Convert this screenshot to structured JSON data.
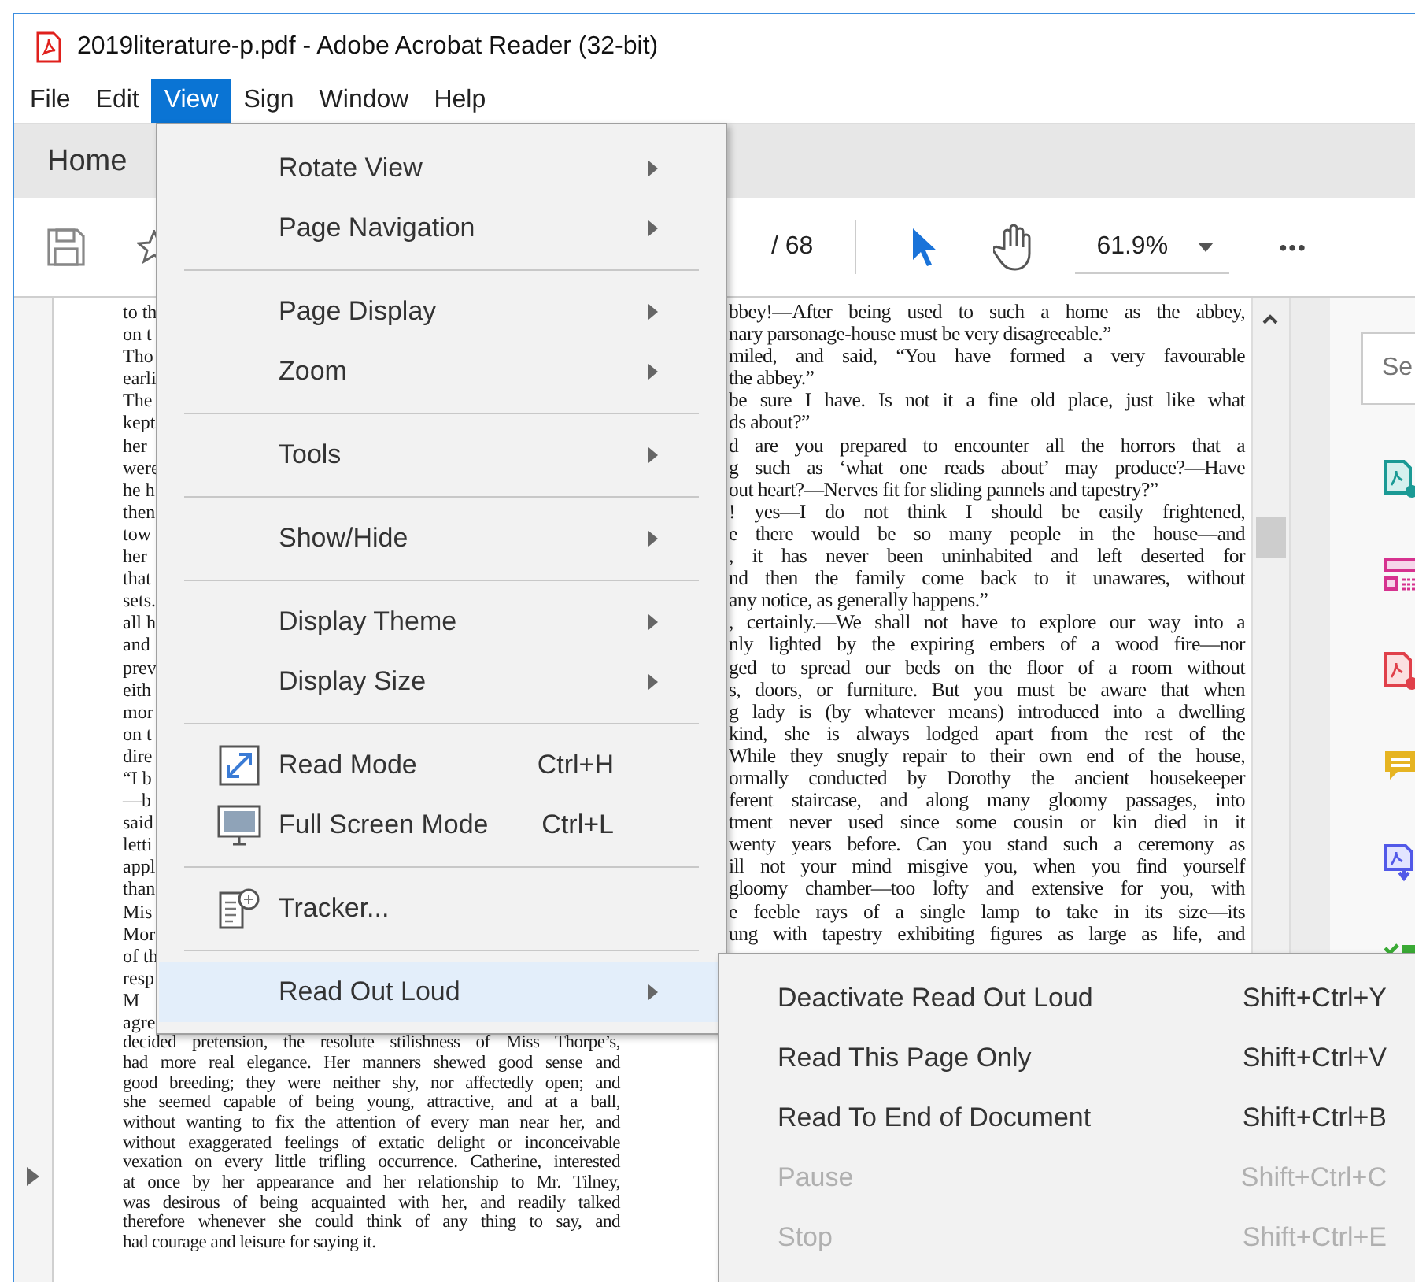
{
  "window": {
    "title": "2019literature-p.pdf - Adobe Acrobat Reader (32-bit)"
  },
  "menu_bar": [
    {
      "label": "File",
      "selected": false
    },
    {
      "label": "Edit",
      "selected": false
    },
    {
      "label": "View",
      "selected": true
    },
    {
      "label": "Sign",
      "selected": false
    },
    {
      "label": "Window",
      "selected": false
    },
    {
      "label": "Help",
      "selected": false
    }
  ],
  "home_tab": {
    "label": "Home"
  },
  "toolbar": {
    "page_total": "/ 68",
    "zoom": "61.9%",
    "more": "•••"
  },
  "view_menu": {
    "items": [
      {
        "kind": "submenu",
        "label": "Rotate View",
        "selected": false
      },
      {
        "kind": "submenu",
        "label": "Page Navigation",
        "selected": false
      },
      {
        "kind": "separator"
      },
      {
        "kind": "submenu",
        "label": "Page Display",
        "selected": false
      },
      {
        "kind": "submenu",
        "label": "Zoom",
        "selected": false
      },
      {
        "kind": "separator"
      },
      {
        "kind": "submenu",
        "label": "Tools",
        "selected": false
      },
      {
        "kind": "separator"
      },
      {
        "kind": "submenu",
        "label": "Show/Hide",
        "selected": false
      },
      {
        "kind": "separator"
      },
      {
        "kind": "submenu",
        "label": "Display Theme",
        "selected": false
      },
      {
        "kind": "submenu",
        "label": "Display Size",
        "selected": false
      },
      {
        "kind": "separator"
      },
      {
        "kind": "command",
        "label": "Read Mode",
        "shortcut": "Ctrl+H",
        "selected": false
      },
      {
        "kind": "command",
        "label": "Full Screen Mode",
        "shortcut": "Ctrl+L",
        "selected": false
      },
      {
        "kind": "separator"
      },
      {
        "kind": "command",
        "label": "Tracker...",
        "selected": false
      },
      {
        "kind": "separator"
      },
      {
        "kind": "submenu",
        "label": "Read Out Loud",
        "selected": true
      }
    ]
  },
  "read_out_loud_submenu": {
    "items": [
      {
        "label": "Deactivate Read Out Loud",
        "shortcut": "Shift+Ctrl+Y",
        "disabled": false
      },
      {
        "label": "Read This Page Only",
        "shortcut": "Shift+Ctrl+V",
        "disabled": false
      },
      {
        "label": "Read To End of Document",
        "shortcut": "Shift+Ctrl+B",
        "disabled": false
      },
      {
        "label": "Pause",
        "shortcut": "Shift+Ctrl+C",
        "disabled": true
      },
      {
        "label": "Stop",
        "shortcut": "Shift+Ctrl+E",
        "disabled": true
      }
    ]
  },
  "document": {
    "left_fragments": [
      "to th",
      "on t",
      "Tho",
      "earli",
      "The",
      "kept",
      "her",
      "were",
      "he h",
      "then",
      "tow",
      "her",
      "that",
      "sets.",
      "all h",
      "and",
      "prev",
      "eith",
      "mor",
      "on t",
      "dire",
      "“I b",
      "—b",
      "said",
      "letti",
      "appl",
      "than",
      "Mis",
      "Mor",
      "of th",
      "resp",
      "M",
      "agre"
    ],
    "left_lines": [
      {
        "text": "decided pretension, the resolute stilishness of Miss Thorpe’s,",
        "last": false
      },
      {
        "text": "had more real elegance. Her manners shewed good sense and",
        "last": false
      },
      {
        "text": "good breeding; they were neither shy, nor affectedly open; and",
        "last": false
      },
      {
        "text": "she seemed capable of being young, attractive, and at a ball,",
        "last": false
      },
      {
        "text": "without wanting to fix the attention of every man near her, and",
        "last": false
      },
      {
        "text": "without exaggerated feelings of extatic delight or inconceivable",
        "last": false
      },
      {
        "text": "vexation on every little trifling occurrence. Catherine, interested",
        "last": false
      },
      {
        "text": "at once by her appearance and her relationship to Mr. Tilney,",
        "last": false
      },
      {
        "text": "was desirous of being acquainted with her, and readily talked",
        "last": false
      },
      {
        "text": "therefore whenever she could think of any thing to say, and",
        "last": false
      },
      {
        "text": "had courage and leisure for saying it.",
        "last": true
      }
    ],
    "right_lines": [
      {
        "text": "bbey!—After being used to such a home as the abbey,",
        "last": false
      },
      {
        "text": "nary parsonage-house must be very disagreeable.”",
        "last": true
      },
      {
        "text": "miled, and said, “You have formed a very favourable",
        "last": false
      },
      {
        "text": "the abbey.”",
        "last": true
      },
      {
        "text": "be sure I have. Is not it a fine old place, just like what",
        "last": false
      },
      {
        "text": "ds about?”",
        "last": true
      },
      {
        "text": "d are you prepared to encounter all the horrors that a",
        "last": false
      },
      {
        "text": "g such as ‘what one reads about’ may produce?—Have",
        "last": false
      },
      {
        "text": "out heart?—Nerves fit for sliding pannels and tapestry?”",
        "last": true
      },
      {
        "text": "! yes—I do not think I should be easily frightened,",
        "last": false
      },
      {
        "text": "e there would be so many people in the house—and",
        "last": false
      },
      {
        "text": ", it has never been uninhabited and left deserted for",
        "last": false
      },
      {
        "text": "nd then the family come back to it unawares, without",
        "last": false
      },
      {
        "text": "any notice, as generally happens.”",
        "last": true
      },
      {
        "text": ", certainly.—We shall not have to explore our way into a",
        "last": false
      },
      {
        "text": "nly lighted by the expiring embers of a wood fire—nor",
        "last": false
      },
      {
        "text": "ged to spread our beds on the floor of a room without",
        "last": false
      },
      {
        "text": "s, doors, or furniture. But you must be aware that when",
        "last": false
      },
      {
        "text": "g lady is (by whatever means) introduced into a dwelling",
        "last": false
      },
      {
        "text": "kind, she is always lodged apart from the rest of the",
        "last": false
      },
      {
        "text": "While they snugly repair to their own end of the house,",
        "last": false
      },
      {
        "text": "ormally conducted by Dorothy the ancient housekeeper",
        "last": false
      },
      {
        "text": "ferent staircase, and along many gloomy passages, into",
        "last": false
      },
      {
        "text": "tment never used since some cousin or kin died in it",
        "last": false
      },
      {
        "text": "wenty years before. Can you stand such a ceremony as",
        "last": false
      },
      {
        "text": "ill not your mind misgive you, when you find yourself",
        "last": false
      },
      {
        "text": "gloomy chamber—too lofty and extensive for you, with",
        "last": false
      },
      {
        "text": "e feeble rays of a single lamp to take in its size—its",
        "last": false
      },
      {
        "text": "ung with tapestry exhibiting figures as large as life, and",
        "last": false
      }
    ]
  },
  "right_panel": {
    "search": {
      "placeholder": "Se"
    }
  }
}
